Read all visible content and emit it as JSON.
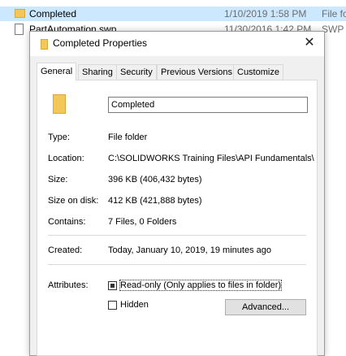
{
  "explorer": {
    "rows": [
      {
        "name": "Completed",
        "date": "1/10/2019 1:58 PM",
        "type": "File fo"
      },
      {
        "name": "PartAutomation.swp",
        "date": "11/30/2016 1:42 PM",
        "type": "SWP F"
      }
    ]
  },
  "dialog": {
    "title": "Completed Properties",
    "close_glyph": "✕",
    "tabs": [
      "General",
      "Sharing",
      "Security",
      "Previous Versions",
      "Customize"
    ],
    "folder_name": "Completed",
    "fields": {
      "type_label": "Type:",
      "type_value": "File folder",
      "location_label": "Location:",
      "location_value": "C:\\SOLIDWORKS Training Files\\API Fundamentals\\",
      "size_label": "Size:",
      "size_value": "396 KB (406,432 bytes)",
      "size_on_disk_label": "Size on disk:",
      "size_on_disk_value": "412 KB (421,888 bytes)",
      "contains_label": "Contains:",
      "contains_value": "7 Files, 0 Folders",
      "created_label": "Created:",
      "created_value": "Today, January 10, 2019, 19 minutes ago",
      "attributes_label": "Attributes:"
    },
    "attributes": {
      "readonly_label": "Read-only (Only applies to files in folder)",
      "readonly_state": "indeterminate",
      "hidden_label": "Hidden",
      "hidden_state": "unchecked",
      "advanced_label": "Advanced..."
    }
  }
}
